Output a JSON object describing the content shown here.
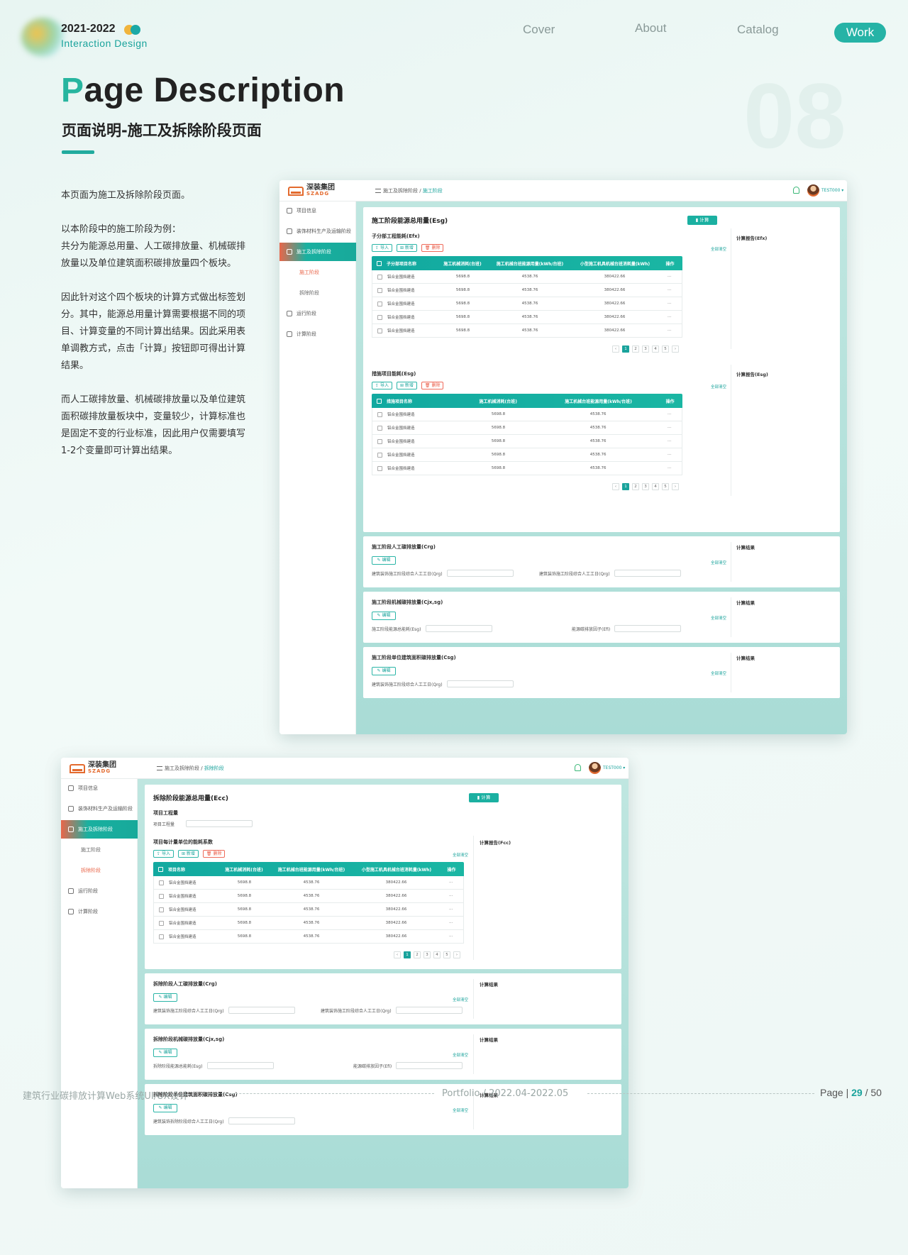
{
  "header": {
    "year": "2021-2022",
    "subtitle": "Interaction Design",
    "nav": [
      "Cover",
      "About",
      "Catalog",
      "Work"
    ],
    "active_nav": "Work",
    "accent": "#26b3a6"
  },
  "title": {
    "first_letter": "P",
    "rest": "age Description",
    "bg_number": "08",
    "cn": "页面说明-施工及拆除阶段页面"
  },
  "description": [
    "本页面为施工及拆除阶段页面。",
    "以本阶段中的施工阶段为例：\n共分为能源总用量、人工碳排放量、机械碳排放量以及单位建筑面积碳排放量四个板块。",
    "因此针对这个四个板块的计算方式做出标签划分。其中，能源总用量计算需要根据不同的项目、计算变量的不同计算出结果。因此采用表单调教方式，点击「计算」按钮即可得出计算结果。",
    "而人工碳排放量、机械碳排放量以及单位建筑面积碳排放量板块中，变量较少，计算标准也是固定不变的行业标准，因此用户仅需要填写1-2个变量即可计算出结果。"
  ],
  "app": {
    "logo_cn": "深装集团",
    "logo_en": "SZADG",
    "user": "TEST000",
    "sidebar": [
      "项目信息",
      "装饰材料生产及运输阶段",
      "施工及拆除阶段",
      "施工阶段",
      "拆除阶段",
      "运行阶段",
      "计算阶段"
    ],
    "buttons": {
      "import": "导入",
      "add": "新增",
      "delete": "删除",
      "calc": "计算",
      "edit": "编辑",
      "clear_all": "全部清空"
    },
    "pages": [
      "1",
      "2",
      "3",
      "4",
      "5"
    ]
  },
  "panel1": {
    "crumb": [
      "施工及拆除阶段",
      "施工阶段"
    ],
    "card_title": "施工阶段能源总用量(Esg)",
    "sub1": {
      "title": "子分部工程能耗(Efx)",
      "report": "计算报告(Efx)",
      "headers": [
        "子分部项目名称",
        "施工机械消耗(台班)",
        "施工机械台班能源用量(kWh/台班)",
        "小型施工机具机械台班消耗量(kWh)",
        "操作"
      ],
      "rows": [
        [
          "铝合金围挡建造",
          "5698.8",
          "4538.76",
          "380422.66",
          "···"
        ],
        [
          "铝合金围挡建造",
          "5698.8",
          "4538.76",
          "380422.66",
          "···"
        ],
        [
          "铝合金围挡建造",
          "5698.8",
          "4538.76",
          "380422.66",
          "···"
        ],
        [
          "铝合金围挡建造",
          "5698.8",
          "4538.76",
          "380422.66",
          "···"
        ],
        [
          "铝合金围挡建造",
          "5698.8",
          "4538.76",
          "380422.66",
          "···"
        ]
      ]
    },
    "sub2": {
      "title": "措施项目能耗(Esg)",
      "report": "计算报告(Esg)",
      "headers": [
        "措施项目名称",
        "施工机械消耗(台班)",
        "施工机械台班能源用量(kWh/台班)",
        "操作"
      ],
      "rows": [
        [
          "铝合金围挡建造",
          "5698.8",
          "4538.76",
          "···"
        ],
        [
          "铝合金围挡建造",
          "5698.8",
          "4538.76",
          "···"
        ],
        [
          "铝合金围挡建造",
          "5698.8",
          "4538.76",
          "···"
        ],
        [
          "铝合金围挡建造",
          "5698.8",
          "4538.76",
          "···"
        ],
        [
          "铝合金围挡建造",
          "5698.8",
          "4538.76",
          "···"
        ]
      ]
    },
    "crg": {
      "title": "施工阶段人工碳排放量(Crg)",
      "result": "计算结果",
      "f1": "建筑装饰施工阶段综合人工工日(Qrg)",
      "f2": "建筑装饰施工阶段综合人工工日(Qrg)"
    },
    "cjx": {
      "title": "施工阶段机械碳排放量(Cjx,sg)",
      "result": "计算结果",
      "f1": "施工阶段能源总能耗(Esg)",
      "f2": "能源碳排放因子(Efi)"
    },
    "csg": {
      "title": "施工阶段单位建筑面积碳排放量(Csg)",
      "result": "计算结果",
      "f1": "建筑装饰施工阶段综合人工工日(Qrg)"
    }
  },
  "panel2": {
    "crumb": [
      "施工及拆除阶段",
      "拆除阶段"
    ],
    "card_title": "拆除阶段能源总用量(Ecc)",
    "qty_title": "项目工程量",
    "qty_label": "项目工程量",
    "sub1": {
      "title": "项目每计量单位的能耗系数",
      "report": "计算报告(Fcc)",
      "headers": [
        "项目名称",
        "施工机械消耗(台班)",
        "施工机械台班能源用量(kWh/台班)",
        "小型施工机具机械台班消耗量(kWh)",
        "操作"
      ],
      "rows": [
        [
          "铝合金围挡建造",
          "5698.8",
          "4538.76",
          "380422.66",
          "···"
        ],
        [
          "铝合金围挡建造",
          "5698.8",
          "4538.76",
          "380422.66",
          "···"
        ],
        [
          "铝合金围挡建造",
          "5698.8",
          "4538.76",
          "380422.66",
          "···"
        ],
        [
          "铝合金围挡建造",
          "5698.8",
          "4538.76",
          "380422.66",
          "···"
        ],
        [
          "铝合金围挡建造",
          "5698.8",
          "4538.76",
          "380422.66",
          "···"
        ]
      ]
    },
    "crg": {
      "title": "拆除阶段人工碳排放量(Crg)",
      "result": "计算结果",
      "f1": "建筑装饰施工阶段综合人工工日(Qrg)",
      "f2": "建筑装饰施工阶段综合人工工日(Qrg)"
    },
    "cjx": {
      "title": "拆除阶段机械碳排放量(Cjx,sg)",
      "result": "计算结果",
      "f1": "拆除阶段能源总能耗(Esg)",
      "f2": "能源碳排放因子(Efi)"
    },
    "csg": {
      "title": "拆除阶段单位建筑面积碳排放量(Csg)",
      "result": "计算结果",
      "f1": "建筑装饰拆除阶段综合人工工日(Qrg)"
    }
  },
  "footer": {
    "left": "建筑行业碳排放计算Web系统UI/UX设计",
    "mid": "Portfolio / 2022.04-2022.05",
    "page_label": "Page |",
    "page_num": "29",
    "page_total": "/ 50"
  }
}
